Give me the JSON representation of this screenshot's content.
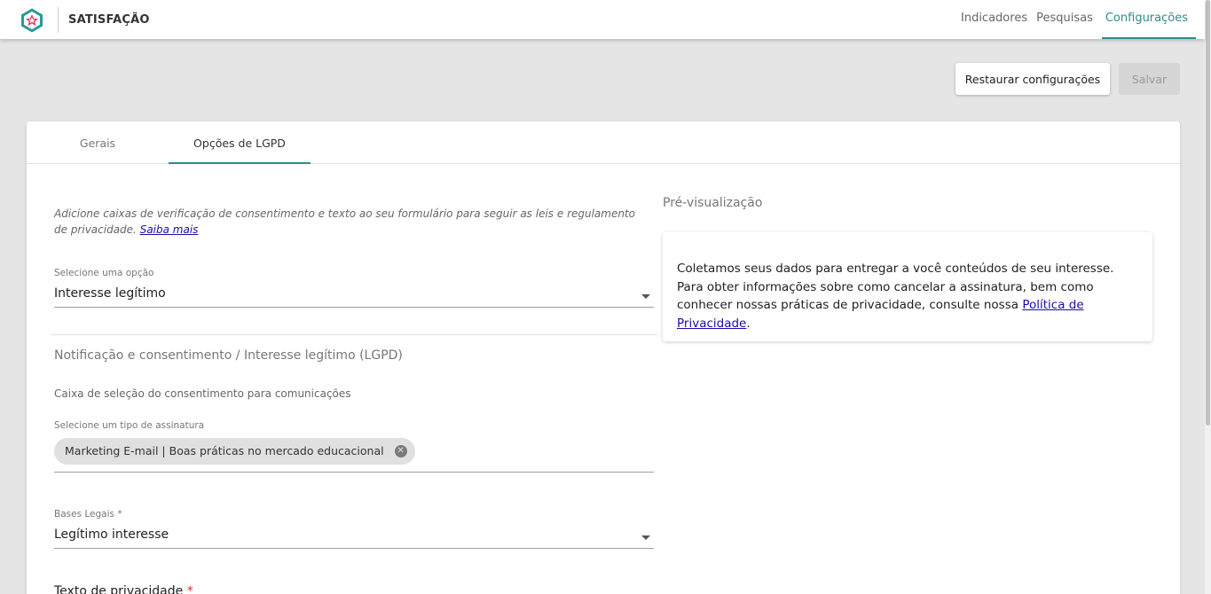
{
  "app": {
    "title": "SATISFAÇÃO",
    "logo_icon": "star-hexagon-icon",
    "accent_color": "#2c8c8c"
  },
  "nav": {
    "items": [
      "Indicadores",
      "Pesquisas",
      "Configurações"
    ],
    "active": "Configurações"
  },
  "actions": {
    "restore_label": "Restaurar configurações",
    "save_label": "Salvar"
  },
  "tabs": {
    "general": "Gerais",
    "lgpd": "Opções de LGPD",
    "active": "Opções de LGPD"
  },
  "intro": {
    "text": "Adicione caixas de verificação de consentimento e texto ao seu formulário para seguir as leis e regulamento de privacidade.",
    "link": "Saiba mais"
  },
  "option_select": {
    "label": "Selecione uma opção",
    "value": "Interesse legítimo"
  },
  "section": {
    "title": "Notificação e consentimento / Interesse legítimo (LGPD)",
    "checkbox_label": "Caixa de seleção do consentimento para comunicações"
  },
  "subscription": {
    "label": "Selecione um tipo de assinatura",
    "chip": "Marketing E-mail | Boas práticas no mercado educacional"
  },
  "legal_bases": {
    "label": "Bases Legais",
    "required_mark": "*",
    "value": "Legítimo interesse"
  },
  "privacy_text": {
    "label": "Texto de privacidade",
    "required_mark": "*"
  },
  "preview": {
    "title": "Pré-visualização",
    "text": "Coletamos seus dados para entregar a você conteúdos de seu interesse. Para obter informações sobre como cancelar a assinatura, bem como conhecer nossas práticas de privacidade, consulte nossa",
    "link": "Política de Privacidade",
    "suffix": "."
  }
}
